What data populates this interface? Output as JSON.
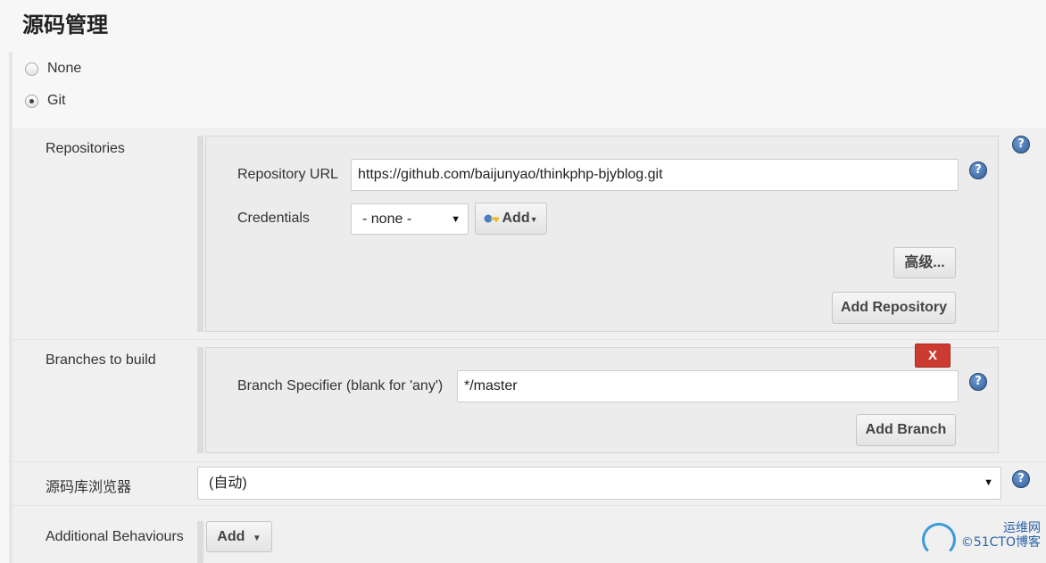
{
  "section_title": "源码管理",
  "scm_options": [
    {
      "label": "None",
      "checked": false
    },
    {
      "label": "Git",
      "checked": true
    }
  ],
  "repositories": {
    "label": "Repositories",
    "url_label": "Repository URL",
    "url_value": "https://github.com/baijunyao/thinkphp-bjyblog.git",
    "credentials_label": "Credentials",
    "credentials_value": "- none -",
    "add_label": "Add",
    "advanced_label": "高级...",
    "add_repository_label": "Add Repository"
  },
  "branches": {
    "label": "Branches to build",
    "delete_label": "X",
    "specifier_label": "Branch Specifier (blank for 'any')",
    "specifier_value": "*/master",
    "add_branch_label": "Add Branch"
  },
  "browser": {
    "label": "源码库浏览器",
    "value": "(自动)"
  },
  "behaviours": {
    "label": "Additional Behaviours",
    "add_label": "Add"
  },
  "help_icon_text": "?",
  "watermark": {
    "line1": "运维网",
    "line2": "©51CTO博客"
  },
  "colors": {
    "delete_button": "#cc3b30",
    "help_icon": "#2f5e9a"
  }
}
